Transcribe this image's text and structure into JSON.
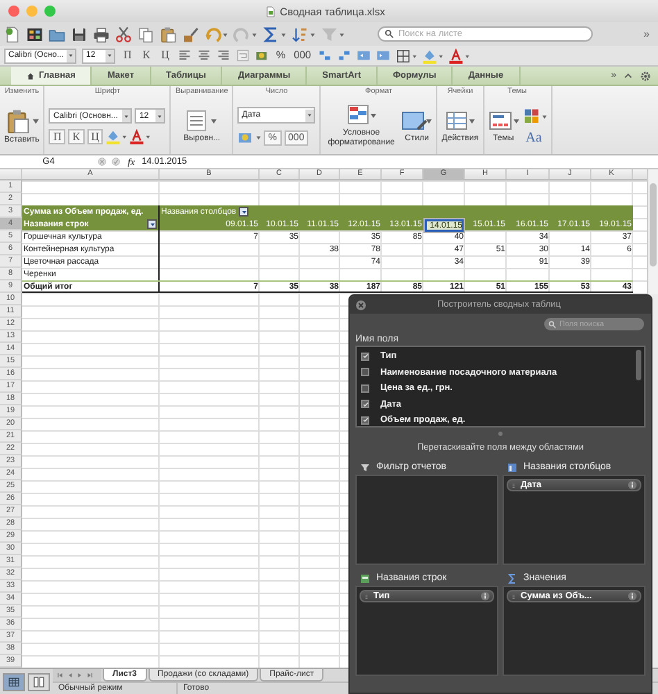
{
  "window": {
    "title": "Сводная таблица.xlsx"
  },
  "toolbar": {
    "search_placeholder": "Поиск на листе",
    "overflow": "»"
  },
  "format_bar": {
    "font": "Calibri (Осно...",
    "size": "12",
    "style_buttons": [
      "П",
      "К",
      "Ц"
    ],
    "percent": "%",
    "thousands": "000"
  },
  "tabs": [
    {
      "label": "Главная",
      "selected": true
    },
    {
      "label": "Макет",
      "selected": false
    },
    {
      "label": "Таблицы",
      "selected": false
    },
    {
      "label": "Диаграммы",
      "selected": false
    },
    {
      "label": "SmartArt",
      "selected": false
    },
    {
      "label": "Формулы",
      "selected": false
    },
    {
      "label": "Данные",
      "selected": false
    }
  ],
  "tabs_overflow": "»",
  "ribbon": {
    "groups": [
      {
        "kind": "edit",
        "label": "Изменить",
        "button": "Вставить"
      },
      {
        "kind": "font",
        "label": "Шрифт",
        "font": "Calibri (Основн...",
        "size": "12",
        "style_buttons": [
          "П",
          "К",
          "Ц"
        ]
      },
      {
        "kind": "align",
        "label": "Выравнивание",
        "button": "Выровн..."
      },
      {
        "kind": "number",
        "label": "Число",
        "format": "Дата",
        "percent": "%",
        "thousands": "000"
      },
      {
        "kind": "format",
        "label": "Формат",
        "buttons": [
          "Условное форматирование",
          "Стили"
        ]
      },
      {
        "kind": "cells",
        "label": "Ячейки",
        "button": "Действия"
      },
      {
        "kind": "themes",
        "label": "Темы",
        "button": "Темы",
        "font_button": "Aa"
      }
    ]
  },
  "formula_bar": {
    "cell": "G4",
    "fx": "fx",
    "value": "14.01.2015"
  },
  "sheet": {
    "columns": [
      {
        "label": "A",
        "selected": false
      },
      {
        "label": "B",
        "selected": false
      },
      {
        "label": "C",
        "selected": false
      },
      {
        "label": "D",
        "selected": false
      },
      {
        "label": "E",
        "selected": false
      },
      {
        "label": "F",
        "selected": false
      },
      {
        "label": "G",
        "selected": true
      },
      {
        "label": "H",
        "selected": false
      },
      {
        "label": "I",
        "selected": false
      },
      {
        "label": "J",
        "selected": false
      },
      {
        "label": "K",
        "selected": false
      }
    ],
    "rows": [
      {
        "n": "1",
        "selected": false,
        "kind": "blank"
      },
      {
        "n": "2",
        "selected": false,
        "kind": "blank"
      },
      {
        "n": "3",
        "selected": false,
        "kind": "pivot_title",
        "cells": [
          "Сумма из Объем продаж, ед.",
          "Названия столбцов"
        ]
      },
      {
        "n": "4",
        "selected": true,
        "kind": "pivot_header",
        "cells": [
          "Названия строк",
          "09.01.15",
          "10.01.15",
          "11.01.15",
          "12.01.15",
          "13.01.15",
          "14.01.15",
          "15.01.15",
          "16.01.15",
          "17.01.15",
          "19.01.15"
        ]
      },
      {
        "n": "5",
        "selected": false,
        "kind": "item",
        "cells": [
          "Горшечная культура",
          "7",
          "35",
          null,
          "35",
          "85",
          "40",
          null,
          "34",
          null,
          "37"
        ]
      },
      {
        "n": "6",
        "selected": false,
        "kind": "item",
        "cells": [
          "Контейнерная культура",
          null,
          null,
          "38",
          "78",
          null,
          "47",
          "51",
          "30",
          "14",
          "6"
        ]
      },
      {
        "n": "7",
        "selected": false,
        "kind": "item",
        "cells": [
          "Цветочная рассада",
          null,
          null,
          null,
          "74",
          null,
          "34",
          null,
          "91",
          "39",
          null
        ]
      },
      {
        "n": "8",
        "selected": false,
        "kind": "item",
        "cells": [
          "Черенки"
        ]
      },
      {
        "n": "9",
        "selected": false,
        "kind": "total",
        "cells": [
          "Общий итог",
          "7",
          "35",
          "38",
          "187",
          "85",
          "121",
          "51",
          "155",
          "53",
          "43"
        ]
      },
      {
        "n": "10",
        "selected": false,
        "kind": "blank"
      },
      {
        "n": "11",
        "selected": false,
        "kind": "blank"
      },
      {
        "n": "12",
        "selected": false,
        "kind": "blank"
      },
      {
        "n": "13",
        "selected": false,
        "kind": "blank"
      },
      {
        "n": "14",
        "selected": false,
        "kind": "blank"
      },
      {
        "n": "15",
        "selected": false,
        "kind": "blank"
      },
      {
        "n": "16",
        "selected": false,
        "kind": "blank"
      },
      {
        "n": "17",
        "selected": false,
        "kind": "blank"
      },
      {
        "n": "18",
        "selected": false,
        "kind": "blank"
      },
      {
        "n": "19",
        "selected": false,
        "kind": "blank"
      },
      {
        "n": "20",
        "selected": false,
        "kind": "blank"
      },
      {
        "n": "21",
        "selected": false,
        "kind": "blank"
      },
      {
        "n": "22",
        "selected": false,
        "kind": "blank"
      },
      {
        "n": "23",
        "selected": false,
        "kind": "blank"
      },
      {
        "n": "24",
        "selected": false,
        "kind": "blank"
      },
      {
        "n": "25",
        "selected": false,
        "kind": "blank"
      },
      {
        "n": "26",
        "selected": false,
        "kind": "blank"
      },
      {
        "n": "27",
        "selected": false,
        "kind": "blank"
      },
      {
        "n": "28",
        "selected": false,
        "kind": "blank"
      },
      {
        "n": "29",
        "selected": false,
        "kind": "blank"
      },
      {
        "n": "30",
        "selected": false,
        "kind": "blank"
      },
      {
        "n": "31",
        "selected": false,
        "kind": "blank"
      },
      {
        "n": "32",
        "selected": false,
        "kind": "blank"
      },
      {
        "n": "33",
        "selected": false,
        "kind": "blank"
      },
      {
        "n": "34",
        "selected": false,
        "kind": "blank"
      },
      {
        "n": "35",
        "selected": false,
        "kind": "blank"
      },
      {
        "n": "36",
        "selected": false,
        "kind": "blank"
      },
      {
        "n": "37",
        "selected": false,
        "kind": "blank"
      },
      {
        "n": "38",
        "selected": false,
        "kind": "blank"
      },
      {
        "n": "39",
        "selected": false,
        "kind": "blank"
      }
    ]
  },
  "pivot_builder": {
    "title": "Построитель сводных таблиц",
    "search_placeholder": "Поля поиска",
    "fields_label": "Имя поля",
    "fields": [
      {
        "name": "Тип",
        "checked": true
      },
      {
        "name": "Наименование посадочного материала",
        "checked": false
      },
      {
        "name": "Цена за ед., грн.",
        "checked": false
      },
      {
        "name": "Дата",
        "checked": true
      },
      {
        "name": "Объем продаж, ед.",
        "checked": true
      }
    ],
    "hint": "Перетаскивайте поля между областями",
    "areas": [
      {
        "kind": "filter",
        "label": "Фильтр отчетов"
      },
      {
        "kind": "columns",
        "label": "Названия столбцов",
        "items": [
          "Дата"
        ]
      },
      {
        "kind": "rows",
        "label": "Названия строк",
        "items": [
          "Тип"
        ]
      },
      {
        "kind": "values",
        "label": "Значения",
        "items": [
          "Сумма из Объ..."
        ]
      }
    ]
  },
  "view_buttons": [
    {
      "selected": true
    },
    {
      "selected": false
    }
  ],
  "sheet_tabs": [
    {
      "label": "Лист3",
      "selected": true
    },
    {
      "label": "Продажи (со складами)",
      "selected": false
    },
    {
      "label": "Прайс-лист",
      "selected": false
    }
  ],
  "status_bar": {
    "mode": "Обычный режим",
    "state": "Готово"
  }
}
